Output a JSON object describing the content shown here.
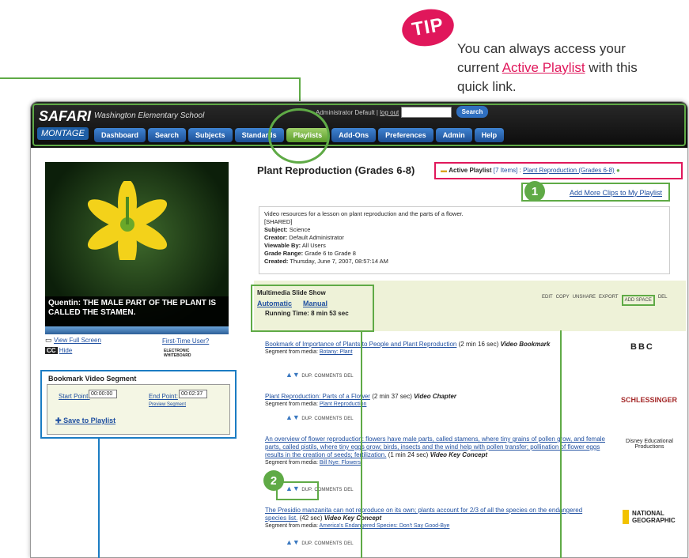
{
  "tip": {
    "badge": "TIP",
    "line1": "You can always access your",
    "line2_pre": "current ",
    "line2_link": "Active Playlist",
    "line2_post": " with this",
    "line3": "quick link."
  },
  "app": {
    "logo_top": "SAFARI",
    "logo_bottom": "MONTAGE",
    "school": "Washington Elementary School",
    "admin_text": "Administrator Default",
    "logout": "log out",
    "search_label": "Search",
    "nav": [
      "Dashboard",
      "Search",
      "Subjects",
      "Standards",
      "Playlists",
      "Add-Ons",
      "Preferences",
      "Admin",
      "Help"
    ]
  },
  "video": {
    "caption": "Quentin: THE MALE PART OF THE PLANT IS CALLED THE STAMEN.",
    "view_full": "View Full Screen",
    "first_time": "First-Time User?",
    "cc": "CC",
    "hide": "Hide",
    "whiteboard": "ELECTRONIC WHITEBOARD"
  },
  "bookmark": {
    "title": "Bookmark Video Segment",
    "start_label": "Start Point:",
    "start_value": "00:00:00",
    "end_label": "End Point:",
    "end_value": "00:02:37",
    "preview": "Preview Segment",
    "save": "Save to Playlist"
  },
  "playlist": {
    "title": "Plant Reproduction (Grades 6-8)",
    "active_label": "Active Playlist",
    "active_count": "[7 Items]",
    "active_name": "Plant Reproduction (Grades 6-8)",
    "add_more": "Add More Clips to My Playlist",
    "description": "Video resources for a lesson on plant reproduction and the parts of a flower.",
    "shared": "[SHARED]",
    "meta": [
      {
        "k": "Subject:",
        "v": "Science"
      },
      {
        "k": "Creator:",
        "v": "Default Administrator"
      },
      {
        "k": "Viewable By:",
        "v": "All Users"
      },
      {
        "k": "Grade Range:",
        "v": "Grade 6 to Grade 8"
      },
      {
        "k": "Created:",
        "v": "Thursday, June 7, 2007, 08:57:14 AM"
      }
    ],
    "slideshow_title": "Multimedia Slide Show",
    "automatic": "Automatic",
    "manual": "Manual",
    "running_time": "Running Time: 8 min 53 sec",
    "toolbar": [
      "EDIT",
      "COPY",
      "UNSHARE",
      "EXPORT",
      "ADD SPACE",
      "DEL"
    ]
  },
  "items": [
    {
      "title": "Bookmark of Importance of Plants to People and Plant Reproduction",
      "duration": "(2 min 16 sec)",
      "kind": "Video Bookmark",
      "segment_label": "Segment from media:",
      "segment": "Botany: Plant",
      "publisher": "BBC"
    },
    {
      "title": "Plant Reproduction: Parts of a Flower",
      "duration": "(2 min 37 sec)",
      "kind": "Video Chapter",
      "segment_label": "Segment from media:",
      "segment": "Plant Reproduction",
      "publisher": "SCHLESSINGER"
    },
    {
      "title": "An overview of flower reproduction: flowers have male parts, called stamens, where tiny grains of pollen grow, and female parts, called pistils, where tiny eggs grow; birds, insects and the wind help with pollen transfer; pollination of flower eggs results in the creation of seeds; fertilization.",
      "duration": "(1 min 24 sec)",
      "kind": "Video Key Concept",
      "segment_label": "Segment from media:",
      "segment": "Bill Nye: Flowers",
      "publisher": "Disney Educational Productions"
    },
    {
      "title": "The Presidio manzanita can not reproduce on its own; plants account for 2/3 of all the species on the endangered species list.",
      "duration": "(42 sec)",
      "kind": "Video Key Concept",
      "segment_label": "Segment from media:",
      "segment": "America's Endangered Species: Don't Say Good-Bye",
      "publisher": "NATIONAL GEOGRAPHIC"
    }
  ],
  "row_tools": [
    "DUP.",
    "COMMENTS",
    "DEL"
  ],
  "callouts": {
    "one": "1",
    "two": "2"
  },
  "colors": {
    "accent_green": "#5faa46",
    "accent_pink": "#e0175b",
    "accent_blue": "#1b7cc3"
  }
}
